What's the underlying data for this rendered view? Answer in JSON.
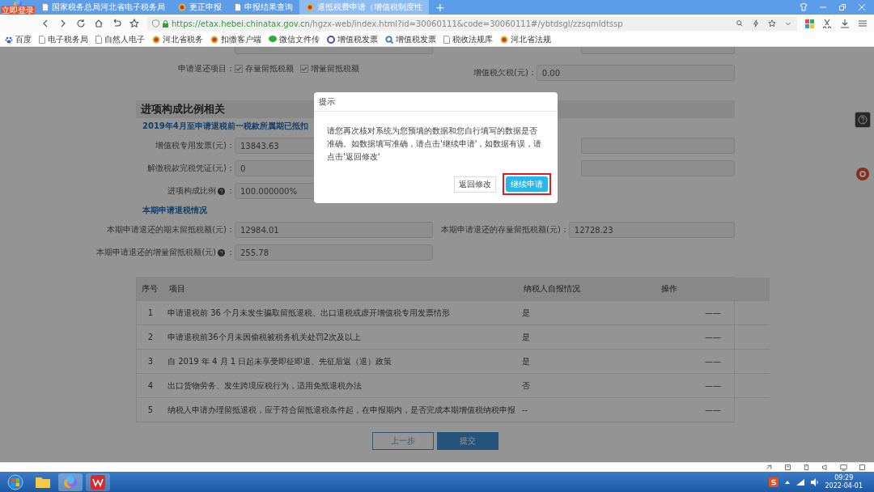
{
  "browser": {
    "login_badge": "立即登录",
    "tabs": [
      {
        "title": "国家税务总局河北省电子税务局",
        "kind": "page",
        "selected": false
      },
      {
        "title": "更正申报",
        "kind": "emblem",
        "selected": false
      },
      {
        "title": "申报结果查询",
        "kind": "page",
        "selected": false
      },
      {
        "title": "退抵税费申请（增值税制度性",
        "kind": "emblem",
        "selected": true
      }
    ],
    "new_tab": "+",
    "url_host": "https://etax.hebei.chinatax.gov.cn",
    "url_path": "/hgzx-web/index.html?id=30060111&code=30060111#/ybtdsgl/zzsqmldtssp",
    "bookmarks": [
      {
        "label": "百度",
        "kind": "paw"
      },
      {
        "label": "电子税务局",
        "kind": "page"
      },
      {
        "label": "自然人电子",
        "kind": "page"
      },
      {
        "label": "河北省税务",
        "kind": "emblem"
      },
      {
        "label": "扣缴客户端",
        "kind": "emblem"
      },
      {
        "label": "微信文件传",
        "kind": "chat"
      },
      {
        "label": "增值税发票",
        "kind": "ring"
      },
      {
        "label": "增值税发票",
        "kind": "search"
      },
      {
        "label": "税收法规库",
        "kind": "page"
      },
      {
        "label": "河北省法规",
        "kind": "emblem"
      }
    ]
  },
  "form": {
    "refund_items": {
      "label": "申请退还项目：",
      "options": [
        {
          "label": "存量留抵税额",
          "checked": true
        },
        {
          "label": "增量留抵税额",
          "checked": true
        }
      ]
    },
    "tax_arrears": {
      "label": "增值税欠税(元)：",
      "value": "0.00"
    },
    "section_title": "进项构成比例相关",
    "subheading_1": "2019年4月至申请退税前一税款所属期已抵扣",
    "fields_1": [
      {
        "label": "增值税专用发票(元)：",
        "value": "13843.63",
        "help": false
      },
      {
        "label": "解缴税款完税凭证(元)：",
        "value": "0",
        "help": false
      },
      {
        "label": "进项构成比例",
        "suffix": "：",
        "value": "100.000000%",
        "help": true
      }
    ],
    "subheading_2": "本期申请退税情况",
    "fields_2": [
      {
        "label": "本期申请退还的期末留抵税额(元)：",
        "value": "12984.01",
        "help": false
      },
      {
        "label": "本期申请退还的存量留抵税额(元)：",
        "value": "12728.23",
        "help": false
      },
      {
        "label": "本期申请退还的增量留抵税额(元)",
        "suffix": "：",
        "value": "255.78",
        "help": true
      }
    ],
    "table": {
      "columns": [
        "序号",
        "项目",
        "纳税人自报情况",
        "操作"
      ],
      "rows": [
        {
          "no": "1",
          "item": "申请退税前 36 个月未发生骗取留抵退税、出口退税或虚开增值税专用发票情形",
          "answer": "是",
          "action": "——"
        },
        {
          "no": "2",
          "item": "申请退税前36个月未因偷税被税务机关处罚2次及以上",
          "answer": "是",
          "action": "——"
        },
        {
          "no": "3",
          "item": "自 2019 年 4 月 1 日起未享受即征即退、先征后返（退）政策",
          "answer": "是",
          "action": "——"
        },
        {
          "no": "4",
          "item": "出口货物劳务、发生跨境应税行为，适用免抵退税办法",
          "answer": "否",
          "action": "——"
        },
        {
          "no": "5",
          "item": "纳税人申请办理留抵退税，应于符合留抵退税条件起，在申报期内，是否完成本期增值税纳税申报",
          "answer": "--",
          "action": "——"
        }
      ]
    },
    "buttons": {
      "back": "上一步",
      "submit": "提交"
    }
  },
  "dialog": {
    "title": "提示",
    "message": "请您再次核对系统为您预填的数据和您自行填写的数据是否准确。如数据填写准确，请点击'继续申请'，如数据有误，请点击'返回修改'",
    "cancel": "返回修改",
    "confirm": "继续申请"
  },
  "taskbar": {
    "time": "09:29",
    "date": "2022-04-01"
  }
}
